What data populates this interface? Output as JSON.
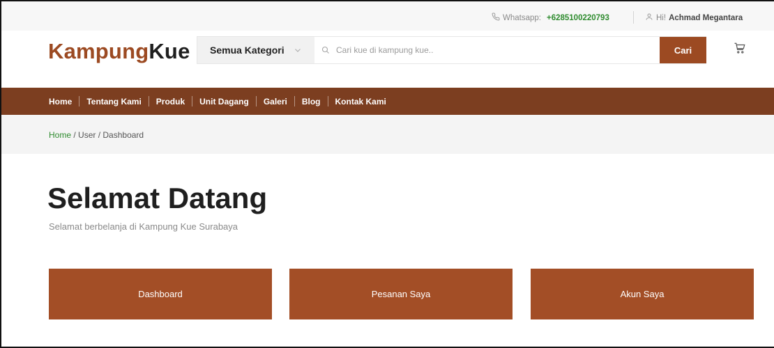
{
  "topbar": {
    "whatsapp_label": "Whatsapp:",
    "whatsapp_number": "+6285100220793",
    "greeting": "Hi!",
    "user_name": "Achmad Megantara"
  },
  "header": {
    "logo_part1": "Kampung",
    "logo_part2": "Kue",
    "category_label": "Semua Kategori",
    "search_placeholder": "Cari kue di kampung kue..",
    "search_button": "Cari"
  },
  "nav": {
    "items": [
      {
        "label": "Home"
      },
      {
        "label": "Tentang Kami"
      },
      {
        "label": "Produk"
      },
      {
        "label": "Unit Dagang"
      },
      {
        "label": "Galeri"
      },
      {
        "label": "Blog"
      },
      {
        "label": "Kontak Kami"
      }
    ]
  },
  "breadcrumb": {
    "home": "Home",
    "user": "User",
    "current": "Dashboard"
  },
  "main": {
    "title": "Selamat Datang",
    "subtitle": "Selamat berbelanja di Kampung Kue Surabaya",
    "cards": [
      {
        "label": "Dashboard"
      },
      {
        "label": "Pesanan Saya"
      },
      {
        "label": "Akun Saya"
      }
    ]
  },
  "colors": {
    "brand": "#9c4a22",
    "nav_bg": "#7c3e20",
    "card_bg": "#a34e26",
    "accent_green": "#2e8b2e"
  }
}
